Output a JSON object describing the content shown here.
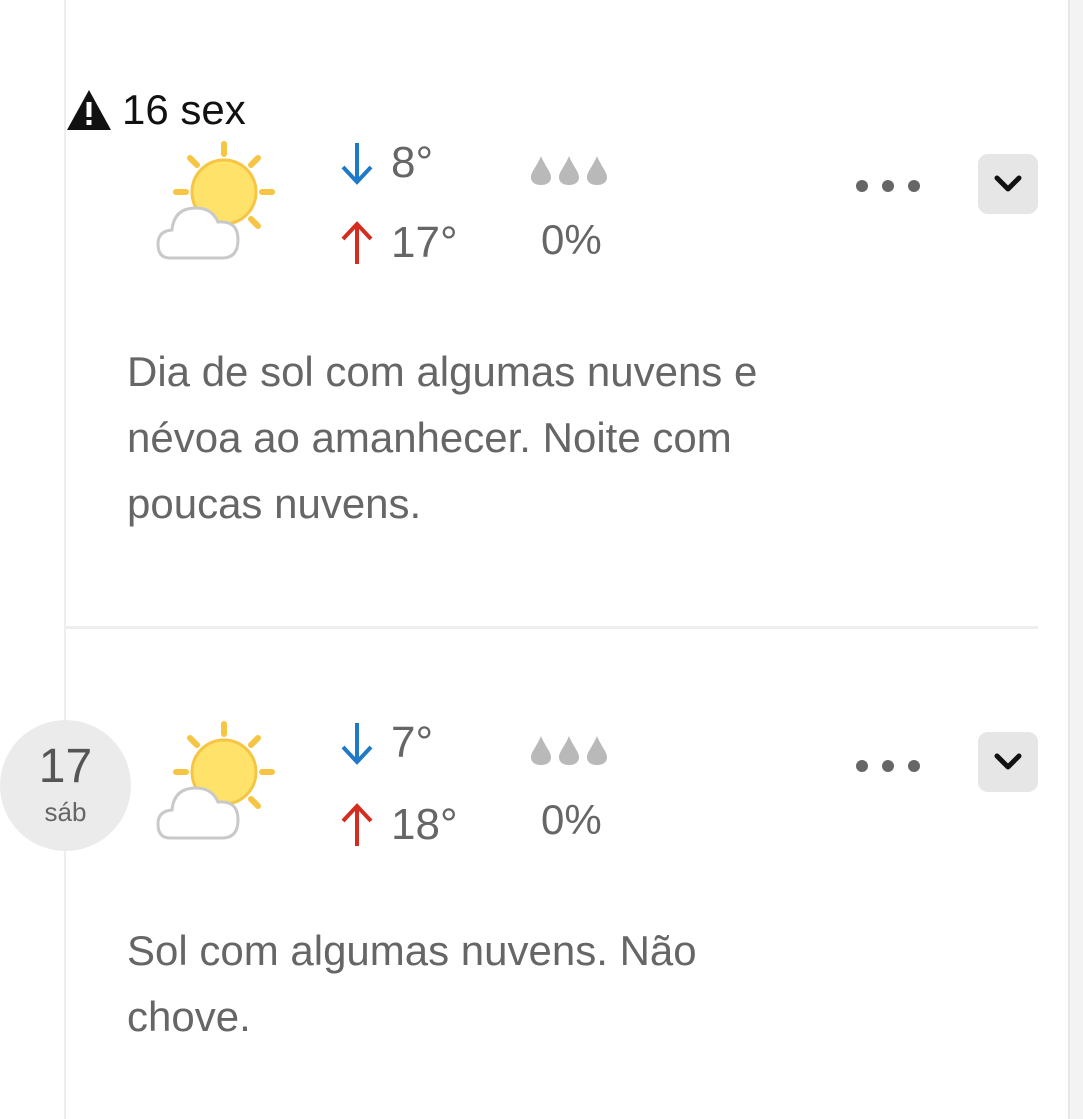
{
  "days": [
    {
      "date_label": "16 sex",
      "has_warning": true,
      "weather_icon": "sun-with-cloud-icon",
      "temp_min": "8°",
      "temp_max": "17°",
      "precip_probability": "0%",
      "precip_level": 0,
      "description": "Dia de sol com algumas nuvens e névoa ao amanhecer. Noite com poucas nuvens."
    },
    {
      "day_number": "17",
      "weekday": "sáb",
      "weather_icon": "sun-with-cloud-icon",
      "temp_min": "7°",
      "temp_max": "18°",
      "precip_probability": "0%",
      "precip_level": 0,
      "description": "Sol com algumas nuvens. Não chove."
    }
  ],
  "colors": {
    "min_arrow": "#1e7ac6",
    "max_arrow": "#d62b1f",
    "sun": "#ffe26a",
    "sun_rays": "#f6c543",
    "drop": "#b9b9b9",
    "text_muted": "#666666"
  }
}
